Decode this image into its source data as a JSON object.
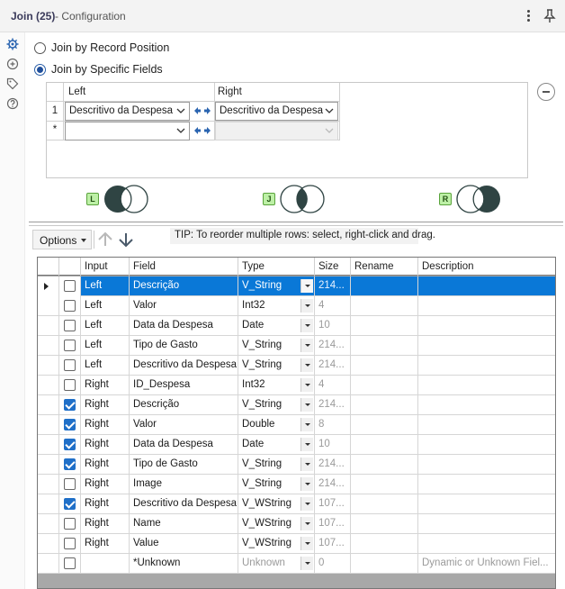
{
  "window": {
    "title": "Join (25)",
    "subtitle": "- Configuration"
  },
  "rail": {
    "icons": [
      "gear-icon",
      "annotation-icon",
      "tag-icon",
      "help-icon"
    ]
  },
  "join_mode": {
    "options": [
      {
        "label": "Join by Record Position",
        "selected": false
      },
      {
        "label": "Join by Specific Fields",
        "selected": true
      }
    ]
  },
  "join_fields": {
    "left_header": "Left",
    "right_header": "Right",
    "rows": [
      {
        "row": "1",
        "left": "Descritivo da Despesa",
        "right": "Descritivo da Despesa"
      },
      {
        "row": "*",
        "left": "",
        "right": ""
      }
    ]
  },
  "venn": [
    {
      "badge": "L",
      "name": "left-unjoined"
    },
    {
      "badge": "J",
      "name": "joined"
    },
    {
      "badge": "R",
      "name": "right-unjoined"
    }
  ],
  "toolbar": {
    "options_label": "Options",
    "tip": "TIP: To reorder multiple rows: select, right-click and drag."
  },
  "table": {
    "columns": [
      "Input",
      "Field",
      "Type",
      "Size",
      "Rename",
      "Description"
    ],
    "rows": [
      {
        "checked": false,
        "input": "Left",
        "field": "Descrição",
        "type": "V_String",
        "size": "214...",
        "rename": "",
        "description": "",
        "selected": true
      },
      {
        "checked": false,
        "input": "Left",
        "field": "Valor",
        "type": "Int32",
        "size": "4",
        "rename": "",
        "description": ""
      },
      {
        "checked": false,
        "input": "Left",
        "field": "Data da Despesa",
        "type": "Date",
        "size": "10",
        "rename": "",
        "description": ""
      },
      {
        "checked": false,
        "input": "Left",
        "field": "Tipo de Gasto",
        "type": "V_String",
        "size": "214...",
        "rename": "",
        "description": ""
      },
      {
        "checked": false,
        "input": "Left",
        "field": "Descritivo da Despesa",
        "type": "V_String",
        "size": "214...",
        "rename": "",
        "description": ""
      },
      {
        "checked": false,
        "input": "Right",
        "field": "ID_Despesa",
        "type": "Int32",
        "size": "4",
        "rename": "",
        "description": ""
      },
      {
        "checked": true,
        "input": "Right",
        "field": "Descrição",
        "type": "V_String",
        "size": "214...",
        "rename": "",
        "description": ""
      },
      {
        "checked": true,
        "input": "Right",
        "field": "Valor",
        "type": "Double",
        "size": "8",
        "rename": "",
        "description": ""
      },
      {
        "checked": true,
        "input": "Right",
        "field": "Data da Despesa",
        "type": "Date",
        "size": "10",
        "rename": "",
        "description": ""
      },
      {
        "checked": true,
        "input": "Right",
        "field": "Tipo de Gasto",
        "type": "V_String",
        "size": "214...",
        "rename": "",
        "description": ""
      },
      {
        "checked": false,
        "input": "Right",
        "field": "Image",
        "type": "V_String",
        "size": "214...",
        "rename": "",
        "description": ""
      },
      {
        "checked": true,
        "input": "Right",
        "field": "Descritivo da Despesa",
        "type": "V_WString",
        "size": "107...",
        "rename": "",
        "description": ""
      },
      {
        "checked": false,
        "input": "Right",
        "field": "Name",
        "type": "V_WString",
        "size": "107...",
        "rename": "",
        "description": ""
      },
      {
        "checked": false,
        "input": "Right",
        "field": "Value",
        "type": "V_WString",
        "size": "107...",
        "rename": "",
        "description": ""
      },
      {
        "checked": false,
        "input": "",
        "field": "*Unknown",
        "type": "Unknown",
        "size": "0",
        "rename": "",
        "description": "Dynamic or Unknown Fiel...",
        "muted": true
      }
    ]
  },
  "colors": {
    "selection": "#0a78d7",
    "checkbox": "#1f6fc8",
    "venn_fill": "#2f4443",
    "badge": "#bdf0a6"
  }
}
